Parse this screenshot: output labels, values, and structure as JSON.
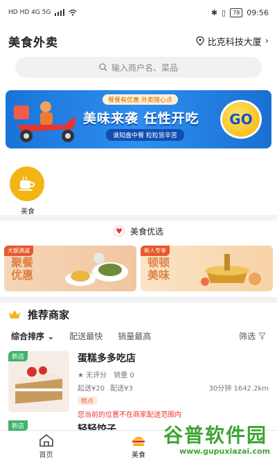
{
  "status": {
    "left_icons": "HD HD 4G 5G",
    "time": "09:56",
    "battery": "78"
  },
  "header": {
    "title": "美食外卖",
    "location": "比克科技大厦"
  },
  "search": {
    "placeholder": "输入商户名、菜品"
  },
  "banner": {
    "tag": "餐餐有优惠 外卖随心点",
    "slogan": "美味来袭 任性开吃",
    "sub": "谁知盘中餐 粒粒皆辛苦",
    "go": "GO"
  },
  "categories": [
    {
      "label": "美食"
    }
  ],
  "selection": {
    "title": "美食优选"
  },
  "promos": [
    {
      "badge": "大额满减",
      "text": "聚餐优惠"
    },
    {
      "badge": "新人专享",
      "text": "顿顿美味"
    }
  ],
  "recommend": {
    "title": "推荐商家",
    "sorts": [
      "综合排序",
      "配送最快",
      "销量最高"
    ],
    "filter": "筛选",
    "shops": [
      {
        "tag": "新店",
        "name": "蛋糕多多吃店",
        "rating": "无评分",
        "sales": "销量 0",
        "min_order": "起送¥20",
        "delivery_fee": "配送¥3",
        "time_distance": "30分钟 1642.2km",
        "chip": "糕点",
        "warn": "您当前的位置不在商家配送范围内"
      },
      {
        "tag": "新店",
        "name": "轻轻饺子"
      }
    ]
  },
  "tabbar": [
    {
      "label": "首页"
    },
    {
      "label": "美食"
    }
  ],
  "watermark": {
    "big": "谷普软件园",
    "small": "www.gupuxiazai.com"
  },
  "colors": {
    "accent": "#f3b515",
    "banner": "#1a74d8",
    "warn": "#e33333",
    "new": "#3fb36a"
  }
}
